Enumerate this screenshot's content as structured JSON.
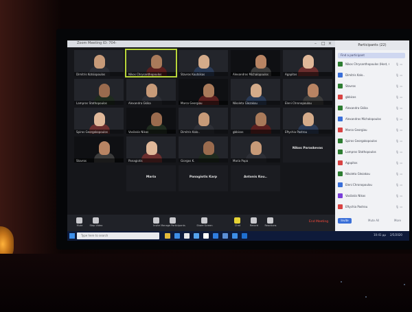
{
  "meeting": {
    "window_title": "Zoom Meeting ID: 704-",
    "participants_panel_title": "Participants (22)",
    "participants_search": "Find a participant",
    "participants": [
      {
        "name": "Nikos Chrysanthopoulos (Host, me)",
        "color": "#2e7d32"
      },
      {
        "name": "Dimitris Kalo..",
        "color": "#3a6fd8"
      },
      {
        "name": "Stavros",
        "color": "#2e7d32"
      },
      {
        "name": "gbbicos",
        "color": "#d84343"
      },
      {
        "name": "Alexandra Gkika",
        "color": "#2e7d32"
      },
      {
        "name": "Alexandros Michalopoulos",
        "color": "#3a6fd8"
      },
      {
        "name": "Marco Georgiou",
        "color": "#d84343"
      },
      {
        "name": "Spiros Georgakopoulos",
        "color": "#2e7d32"
      },
      {
        "name": "Lampros Stathopoulos",
        "color": "#2e7d32"
      },
      {
        "name": "Agapitos",
        "color": "#d84343"
      },
      {
        "name": "Nikoleta Glezakou",
        "color": "#2e7d32"
      },
      {
        "name": "Eleni Chronopoulou",
        "color": "#3a6fd8"
      },
      {
        "name": "Vasilakis Nikos",
        "color": "#7a3fd8"
      },
      {
        "name": "Eftychia Pastrou",
        "color": "#d84343"
      }
    ],
    "participants_footer": {
      "invite": "Invite",
      "mute_all": "Mute All",
      "more": "More"
    },
    "tiles": [
      {
        "name": "Dimitris Kotsiopoulos",
        "kind": "video"
      },
      {
        "name": "Nikos Chrysanthopoulos",
        "kind": "video",
        "active": true
      },
      {
        "name": "Stavros Koutsikas",
        "kind": "video"
      },
      {
        "name": "Alexandros Michalopoulos",
        "kind": "video"
      },
      {
        "name": "Agapitos",
        "kind": "video"
      },
      {
        "name": "Lampros Stathopoulos",
        "kind": "video"
      },
      {
        "name": "Alexandra Gkika",
        "kind": "video"
      },
      {
        "name": "Marco Georgiou",
        "kind": "video"
      },
      {
        "name": "Nikoleta Glezakou",
        "kind": "video"
      },
      {
        "name": "Eleni Chronopoulou",
        "kind": "video"
      },
      {
        "name": "Spiros Georgakopoulos",
        "kind": "video"
      },
      {
        "name": "Vasilakis Nikos",
        "kind": "video"
      },
      {
        "name": "Dimitris Kalo..",
        "kind": "video"
      },
      {
        "name": "gbbicos",
        "kind": "video"
      },
      {
        "name": "Eftychia Pastrou",
        "kind": "video"
      },
      {
        "name": "Stavros",
        "kind": "video"
      },
      {
        "name": "Panagiotis",
        "kind": "video"
      },
      {
        "name": "Giorgos K.",
        "kind": "video"
      },
      {
        "name": "Maria Papa",
        "kind": "video"
      },
      {
        "name": "Nikos Paraskevas",
        "kind": "name-only"
      },
      {
        "name": "Maria",
        "kind": "name-only"
      },
      {
        "name": "Panagiotis Karp",
        "kind": "name-only"
      },
      {
        "name": "Antonis Kou..",
        "kind": "name-only"
      }
    ],
    "toolbar": [
      {
        "label": "Mute",
        "icon": "microphone-icon"
      },
      {
        "label": "Stop Video",
        "icon": "camera-icon"
      },
      {
        "label": "Invite",
        "icon": "invite-icon"
      },
      {
        "label": "Manage Participants",
        "icon": "participants-icon"
      },
      {
        "label": "Share Screen",
        "icon": "share-screen-icon"
      },
      {
        "label": "Chat",
        "icon": "chat-icon"
      },
      {
        "label": "Record",
        "icon": "record-icon"
      },
      {
        "label": "Reactions",
        "icon": "reactions-icon"
      }
    ],
    "end_meeting": "End Meeting"
  },
  "taskbar": {
    "search_placeholder": "Type here to search",
    "time": "10:41 μμ",
    "date": "2/5/2020",
    "apps": [
      "#e2b93b",
      "#3d8ee8",
      "#e8e8e8",
      "#55a3f0",
      "#ffffff",
      "#2f7de1",
      "#5b8fd8",
      "#3d8ee8",
      "#1f6fd0"
    ]
  }
}
